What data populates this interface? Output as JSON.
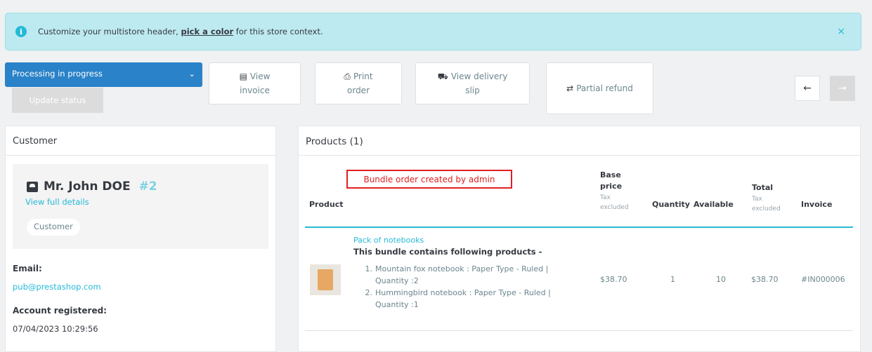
{
  "alert": {
    "text_before": "Customize your multistore header,",
    "link": "pick a color",
    "text_after": "for this store context.",
    "close": "×"
  },
  "toolbar": {
    "status_value": "Processing in progress",
    "update_status": "Update status",
    "view_invoice": [
      "View",
      "invoice"
    ],
    "print_order": [
      "Print",
      "order"
    ],
    "view_delivery": [
      "View delivery",
      "slip"
    ],
    "partial_refund": "Partial refund"
  },
  "customer": {
    "header": "Customer",
    "name": "Mr. John DOE",
    "id": "#2",
    "view_full": "View full details",
    "badge": "Customer",
    "email_label": "Email:",
    "email": "pub@prestashop.com",
    "registered_label": "Account registered:",
    "registered": "07/04/2023 10:29:56"
  },
  "products": {
    "header": "Products (1)",
    "annotation": "Bundle order created by admin",
    "columns": {
      "product": "Product",
      "base_price": [
        "Base",
        "price"
      ],
      "tax_excluded": [
        "Tax",
        "excluded"
      ],
      "quantity": "Quantity",
      "available": "Available",
      "total": "Total",
      "invoice": "Invoice"
    },
    "row": {
      "name": "Pack of notebooks",
      "bundle_title": "This bundle contains following products -",
      "items": [
        {
          "num": "1.",
          "text": "Mountain fox notebook : Paper Type - Ruled | Quantity :2"
        },
        {
          "num": "2.",
          "text": "Hummingbird notebook : Paper Type - Ruled | Quantity :1"
        }
      ],
      "base_price": "$38.70",
      "quantity": "1",
      "available": "10",
      "total": "$38.70",
      "invoice": "#IN000006"
    }
  },
  "colors": {
    "accent": "#25b9d7",
    "status_bg": "#2a82c8",
    "annotation": "#e02020"
  }
}
